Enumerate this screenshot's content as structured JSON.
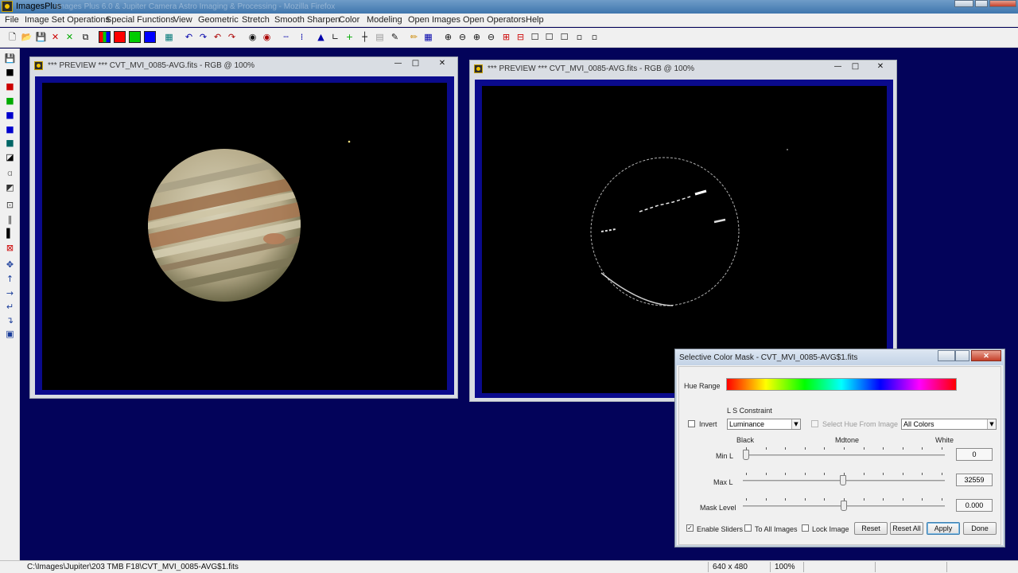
{
  "app": {
    "title": "ImagesPlus",
    "background_title": "Images Plus 6.0 & Jupiter Camera Astro Imaging & Processing - Mozilla Firefox"
  },
  "menu": [
    "File",
    "Image Set Operations",
    "Special Functions",
    "View",
    "Geometric",
    "Stretch",
    "Smooth Sharpen",
    "Color",
    "Modeling",
    "Open Images",
    "Open Operators",
    "Help"
  ],
  "preview_left": {
    "title": "*** PREVIEW *** CVT_MVI_0085-AVG.fits - RGB @ 100%"
  },
  "preview_right": {
    "title": "*** PREVIEW *** CVT_MVI_0085-AVG.fits - RGB @ 100%"
  },
  "dialog": {
    "title": "Selective Color Mask - CVT_MVI_0085-AVG$1.fits",
    "hue_range_label": "Hue Range",
    "ls_constraint_label": "L S Constraint",
    "invert_label": "Invert",
    "invert_checked": false,
    "constraint_select": "Luminance",
    "select_hue_label": "Select Hue From Image",
    "colors_select": "All Colors",
    "black_label": "Black",
    "mdtone_label": "Mdtone",
    "white_label": "White",
    "min_l": {
      "label": "Min L",
      "value": "0",
      "fraction": 0.0
    },
    "max_l": {
      "label": "Max L",
      "value": "32559",
      "fraction": 0.497
    },
    "mask_level": {
      "label": "Mask Level",
      "value": "0.000",
      "fraction": 0.5
    },
    "enable_sliders_label": "Enable Sliders",
    "enable_sliders_checked": true,
    "to_all_images_label": "To All Images",
    "lock_image_label": "Lock Image",
    "reset_label": "Reset",
    "reset_all_label": "Reset All",
    "apply_label": "Apply",
    "done_label": "Done",
    "check_mark": "✓"
  },
  "status": {
    "path": "C:\\Images\\Jupiter\\203 TMB F18\\CVT_MVI_0085-AVG$1.fits",
    "dimensions": "640 x 480",
    "zoom": "100%"
  },
  "window_buttons": {
    "minimize": "—",
    "maximize": "□",
    "close": "✕"
  },
  "colors": {
    "workspace": "#03035a",
    "image_frame": "#0a0a8c",
    "hue_gradient": [
      "#ff0000",
      "#ffff00",
      "#00ff00",
      "#00ffff",
      "#0000ff",
      "#ff00ff",
      "#ff0000"
    ]
  }
}
